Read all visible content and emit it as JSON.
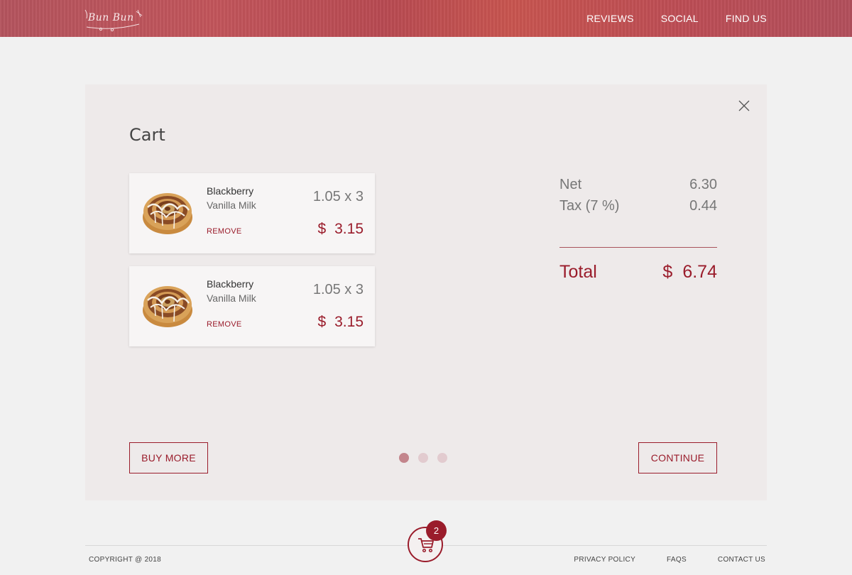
{
  "header": {
    "logo_text": "Bun Bun",
    "nav": [
      "REVIEWS",
      "SOCIAL",
      "FIND US"
    ]
  },
  "cart": {
    "title": "Cart",
    "items": [
      {
        "name": "Blackberry",
        "flavor": "Vanilla Milk",
        "qty_line": "1.05 x 3",
        "currency": "$",
        "price": "3.15",
        "remove_label": "REMOVE"
      },
      {
        "name": "Blackberry",
        "flavor": "Vanilla Milk",
        "qty_line": "1.05 x 3",
        "currency": "$",
        "price": "3.15",
        "remove_label": "REMOVE"
      }
    ],
    "summary": {
      "net_label": "Net",
      "net_value": "6.30",
      "tax_label": "Tax (7 %)",
      "tax_value": "0.44",
      "total_label": "Total",
      "total_currency": "$",
      "total_value": "6.74"
    },
    "buy_more_label": "BUY MORE",
    "continue_label": "CONTINUE",
    "steps": {
      "count": 3,
      "active": 1
    }
  },
  "footer": {
    "copyright": "COPYRIGHT @ 2018",
    "links": [
      "PRIVACY POLICY",
      "FAQS",
      "CONTACT US"
    ],
    "cart_count": "2"
  },
  "colors": {
    "accent": "#9a1c2b",
    "header": "#bd4d55",
    "panel": "#eeeaea"
  }
}
